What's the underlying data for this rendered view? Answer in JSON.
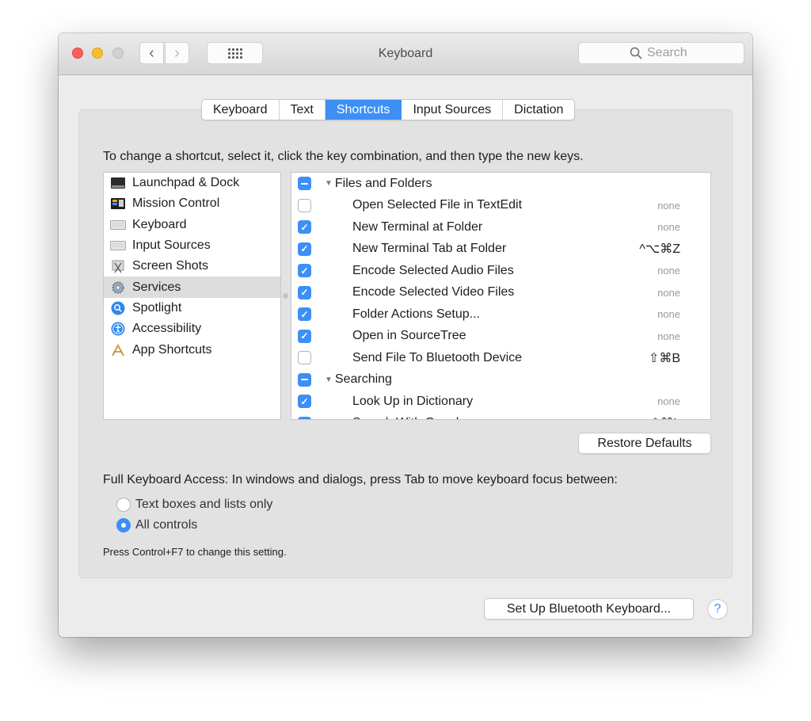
{
  "window": {
    "title": "Keyboard",
    "search_placeholder": "Search"
  },
  "tabs": [
    {
      "label": "Keyboard",
      "active": false
    },
    {
      "label": "Text",
      "active": false
    },
    {
      "label": "Shortcuts",
      "active": true
    },
    {
      "label": "Input Sources",
      "active": false
    },
    {
      "label": "Dictation",
      "active": false
    }
  ],
  "instructions": "To change a shortcut, select it, click the key combination, and then type the new keys.",
  "categories": [
    {
      "label": "Launchpad & Dock",
      "icon": "launchpad-icon"
    },
    {
      "label": "Mission Control",
      "icon": "mission-control-icon"
    },
    {
      "label": "Keyboard",
      "icon": "keyboard-icon"
    },
    {
      "label": "Input Sources",
      "icon": "input-sources-icon"
    },
    {
      "label": "Screen Shots",
      "icon": "screenshot-icon"
    },
    {
      "label": "Services",
      "icon": "gear-icon",
      "selected": true
    },
    {
      "label": "Spotlight",
      "icon": "spotlight-icon"
    },
    {
      "label": "Accessibility",
      "icon": "accessibility-icon"
    },
    {
      "label": "App Shortcuts",
      "icon": "app-shortcuts-icon"
    }
  ],
  "shortcuts": [
    {
      "type": "group",
      "label": "Files and Folders",
      "state": "mixed"
    },
    {
      "type": "item",
      "label": "Open Selected File in TextEdit",
      "state": "off",
      "key": "none"
    },
    {
      "type": "item",
      "label": "New Terminal at Folder",
      "state": "on",
      "key": "none"
    },
    {
      "type": "item",
      "label": "New Terminal Tab at Folder",
      "state": "on",
      "key": "^⌥⌘Z"
    },
    {
      "type": "item",
      "label": "Encode Selected Audio Files",
      "state": "on",
      "key": "none"
    },
    {
      "type": "item",
      "label": "Encode Selected Video Files",
      "state": "on",
      "key": "none"
    },
    {
      "type": "item",
      "label": "Folder Actions Setup...",
      "state": "on",
      "key": "none"
    },
    {
      "type": "item",
      "label": "Open in SourceTree",
      "state": "on",
      "key": "none"
    },
    {
      "type": "item",
      "label": "Send File To Bluetooth Device",
      "state": "off",
      "key": "⇧⌘B"
    },
    {
      "type": "group",
      "label": "Searching",
      "state": "mixed"
    },
    {
      "type": "item",
      "label": "Look Up in Dictionary",
      "state": "on",
      "key": "none"
    },
    {
      "type": "item",
      "label": "Search With Google",
      "state": "on",
      "key": "⇧⌘L"
    }
  ],
  "buttons": {
    "restore_defaults": "Restore Defaults",
    "bluetooth": "Set Up Bluetooth Keyboard...",
    "help": "?"
  },
  "full_keyboard_access": {
    "label": "Full Keyboard Access: In windows and dialogs, press Tab to move keyboard focus between:",
    "options": [
      {
        "label": "Text boxes and lists only",
        "selected": false
      },
      {
        "label": "All controls",
        "selected": true
      }
    ],
    "hint": "Press Control+F7 to change this setting."
  },
  "colors": {
    "accent": "#3d8ff5",
    "close": "#fc5f57",
    "minimize": "#fdbc2e",
    "zoom_disabled": "#d0d0d0"
  }
}
